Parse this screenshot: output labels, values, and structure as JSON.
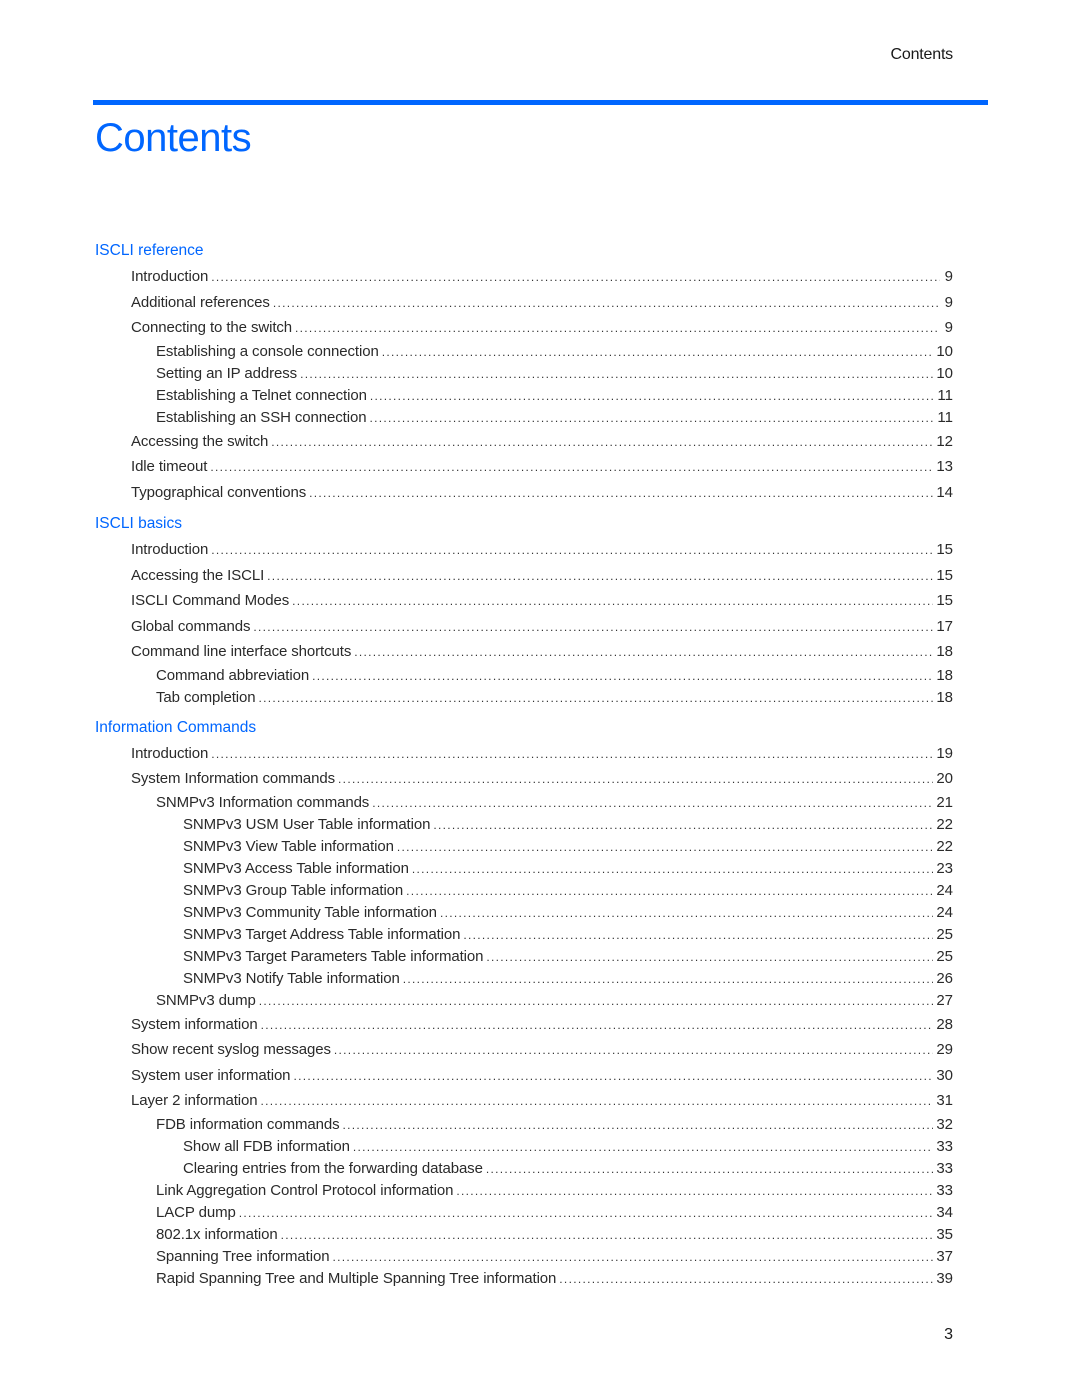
{
  "header": {
    "running_title": "Contents"
  },
  "page_title": "Contents",
  "colors": {
    "accent": "#0066ff",
    "text": "#222222"
  },
  "toc": {
    "sections": [
      {
        "heading": "ISCLI reference",
        "entries": [
          {
            "level": 1,
            "label": "Introduction",
            "page": "9"
          },
          {
            "level": 1,
            "label": "Additional references",
            "page": "9"
          },
          {
            "level": 1,
            "label": "Connecting to the switch",
            "page": "9"
          },
          {
            "level": 2,
            "label": "Establishing a console connection",
            "page": "10"
          },
          {
            "level": 2,
            "label": "Setting an IP address",
            "page": "10"
          },
          {
            "level": 2,
            "label": "Establishing a Telnet connection",
            "page": "11"
          },
          {
            "level": 2,
            "label": "Establishing an SSH connection",
            "page": "11"
          },
          {
            "level": 1,
            "label": "Accessing the switch",
            "page": "12"
          },
          {
            "level": 1,
            "label": "Idle timeout",
            "page": "13"
          },
          {
            "level": 1,
            "label": "Typographical conventions",
            "page": "14"
          }
        ]
      },
      {
        "heading": "ISCLI basics",
        "entries": [
          {
            "level": 1,
            "label": "Introduction",
            "page": "15"
          },
          {
            "level": 1,
            "label": "Accessing the ISCLI",
            "page": "15"
          },
          {
            "level": 1,
            "label": "ISCLI Command Modes",
            "page": "15"
          },
          {
            "level": 1,
            "label": "Global commands",
            "page": "17"
          },
          {
            "level": 1,
            "label": "Command line interface shortcuts",
            "page": "18"
          },
          {
            "level": 2,
            "label": "Command abbreviation",
            "page": "18"
          },
          {
            "level": 2,
            "label": "Tab completion",
            "page": "18"
          }
        ]
      },
      {
        "heading": "Information Commands",
        "entries": [
          {
            "level": 1,
            "label": "Introduction",
            "page": "19"
          },
          {
            "level": 1,
            "label": "System Information commands",
            "page": "20"
          },
          {
            "level": 2,
            "label": "SNMPv3 Information commands",
            "page": "21"
          },
          {
            "level": 3,
            "label": "SNMPv3 USM User Table information",
            "page": "22"
          },
          {
            "level": 3,
            "label": "SNMPv3 View Table information",
            "page": "22"
          },
          {
            "level": 3,
            "label": "SNMPv3 Access Table information",
            "page": "23"
          },
          {
            "level": 3,
            "label": "SNMPv3 Group Table information",
            "page": "24"
          },
          {
            "level": 3,
            "label": "SNMPv3 Community Table information",
            "page": "24"
          },
          {
            "level": 3,
            "label": "SNMPv3 Target Address Table information",
            "page": "25"
          },
          {
            "level": 3,
            "label": "SNMPv3 Target Parameters Table information",
            "page": "25"
          },
          {
            "level": 3,
            "label": "SNMPv3 Notify Table information",
            "page": "26"
          },
          {
            "level": 2,
            "label": "SNMPv3 dump",
            "page": "27"
          },
          {
            "level": 1,
            "label": "System information",
            "page": "28"
          },
          {
            "level": 1,
            "label": "Show recent syslog messages",
            "page": "29"
          },
          {
            "level": 1,
            "label": "System user information",
            "page": "30"
          },
          {
            "level": 1,
            "label": "Layer 2 information",
            "page": "31"
          },
          {
            "level": 2,
            "label": "FDB information commands",
            "page": "32"
          },
          {
            "level": 3,
            "label": "Show all FDB information",
            "page": "33"
          },
          {
            "level": 3,
            "label": "Clearing entries from the forwarding database",
            "page": "33"
          },
          {
            "level": 2,
            "label": "Link Aggregation Control Protocol information",
            "page": "33"
          },
          {
            "level": 2,
            "label": "LACP dump",
            "page": "34"
          },
          {
            "level": 2,
            "label": "802.1x information",
            "page": "35"
          },
          {
            "level": 2,
            "label": "Spanning Tree information",
            "page": "37"
          },
          {
            "level": 2,
            "label": "Rapid Spanning Tree and Multiple Spanning Tree information",
            "page": "39"
          }
        ]
      }
    ]
  },
  "footer": {
    "page_number": "3"
  }
}
